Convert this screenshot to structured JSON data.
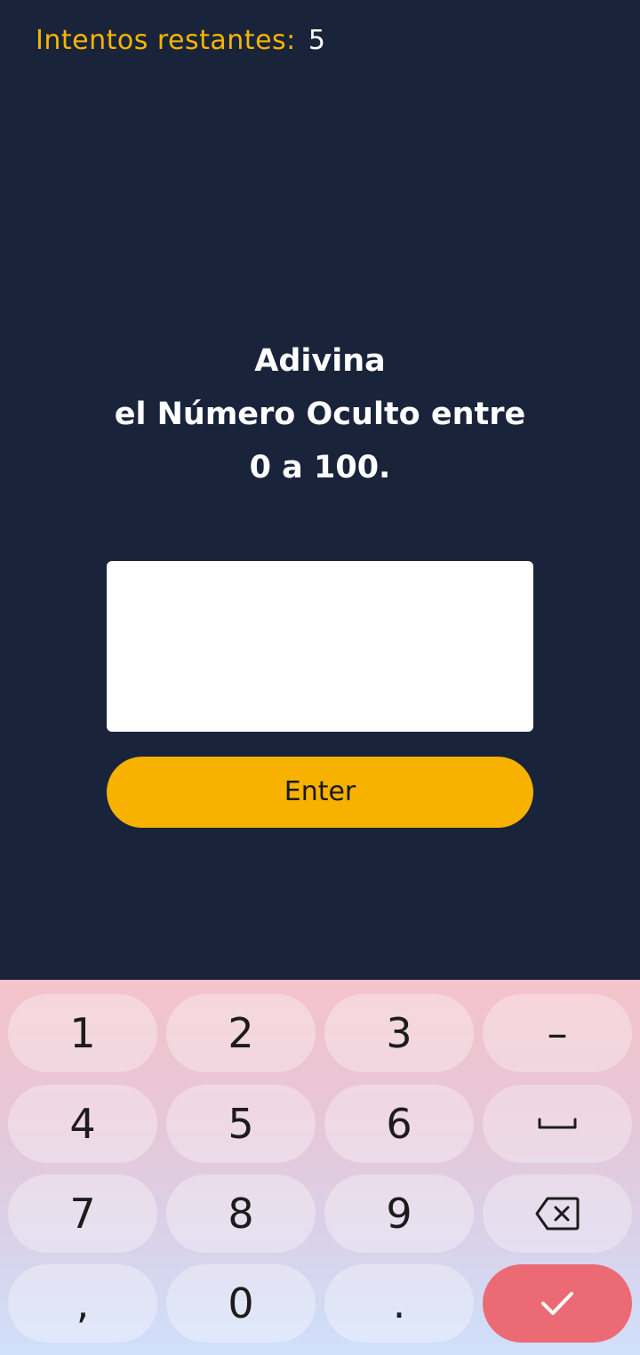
{
  "header": {
    "attempts_label": "Intentos restantes:",
    "attempts_value": "5"
  },
  "prompt": {
    "line1": "Adivina",
    "line2": "el Número Oculto entre",
    "line3": "0 a 100."
  },
  "guess_input": {
    "value": "",
    "placeholder": ""
  },
  "enter_button": {
    "label": "Enter"
  },
  "keyboard": {
    "keys": [
      "1",
      "2",
      "3",
      "–",
      "4",
      "5",
      "6",
      "space",
      "7",
      "8",
      "9",
      "backspace",
      ",",
      "0",
      ".",
      "done"
    ],
    "labels": {
      "k1": "1",
      "k2": "2",
      "k3": "3",
      "minus": "–",
      "k4": "4",
      "k5": "5",
      "k6": "6",
      "k7": "7",
      "k8": "8",
      "k9": "9",
      "comma": ",",
      "k0": "0",
      "period": "."
    },
    "icons": {
      "space": "space-icon",
      "backspace": "backspace-icon",
      "done": "check-icon"
    }
  },
  "colors": {
    "background": "#19243b",
    "accent": "#f7b200",
    "done_key": "#ec6a74"
  }
}
